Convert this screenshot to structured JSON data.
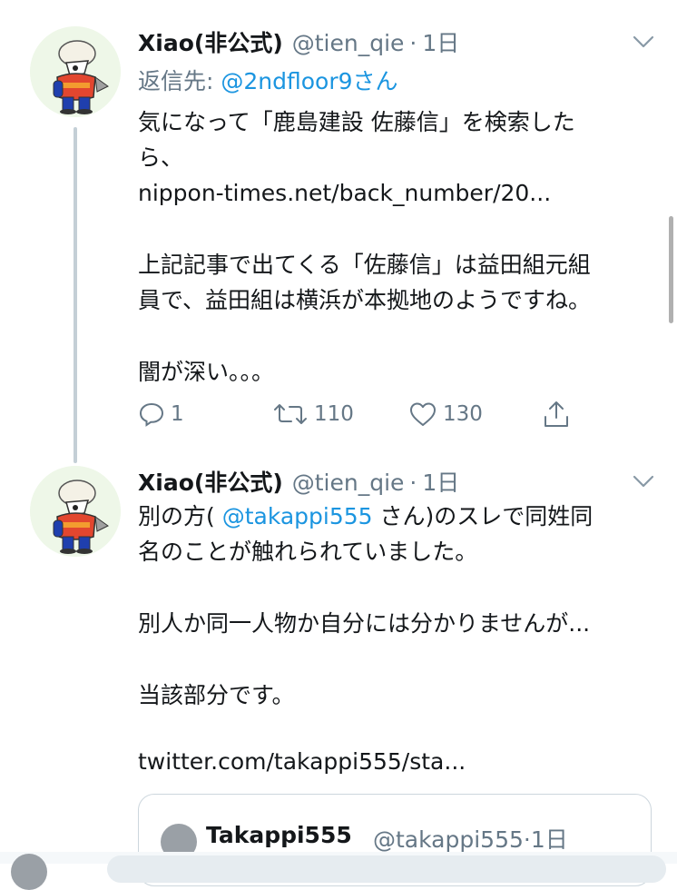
{
  "tweet1": {
    "name": "Xiao(非公式)",
    "handle": "@tien_qie",
    "separator": "·",
    "time": "1日",
    "reply_prefix": "返信先: ",
    "reply_to": "@2ndfloor9さん",
    "lines": [
      "気になって「鹿島建設 佐藤信」を検索した",
      "ら、",
      "nippon-times.net/back_number/20...",
      "上記記事で出てくる「佐藤信」は益田組元組",
      "員で、益田組は横浜が本拠地のようですね。",
      "闇が深い。。。"
    ],
    "reply_count": "1",
    "retweet_count": "110",
    "like_count": "130"
  },
  "tweet2": {
    "name": "Xiao(非公式)",
    "handle": "@tien_qie",
    "separator": "·",
    "time": "1日",
    "line1_pre": "別の方( ",
    "line1_mention": "@takappi555",
    "line1_post": " さん)のスレで同姓同",
    "lines": [
      "名のことが触れられていました。",
      "別人か同一人物か自分には分かりませんが...",
      "当該部分です。",
      "twitter.com/takappi555/sta..."
    ]
  },
  "quoted": {
    "name": "Takappi555",
    "handle": "@takappi555",
    "separator": "·",
    "time": "1日"
  },
  "colors": {
    "link": "#1b95e0",
    "secondary": "#657786",
    "text": "#14171a",
    "thread_line": "#c4cfd6"
  },
  "icons": [
    "avatar-mascot",
    "chevron-down-icon",
    "reply-icon",
    "retweet-icon",
    "like-icon",
    "share-icon"
  ]
}
